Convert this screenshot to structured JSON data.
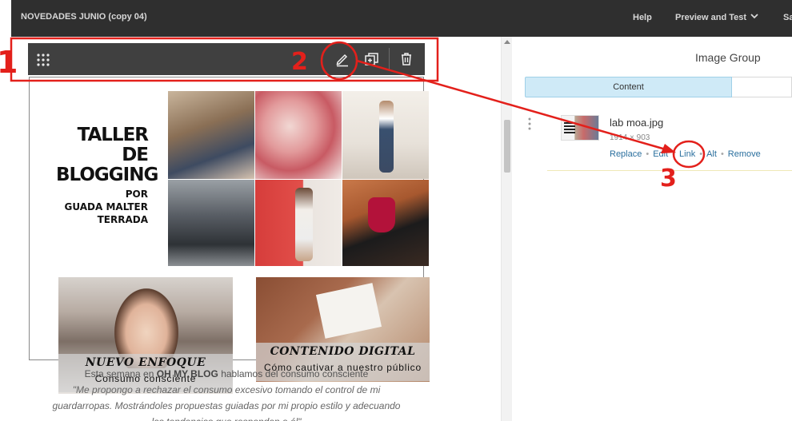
{
  "topbar": {
    "title": "NOVEDADES JUNIO (copy 04)",
    "help": "Help",
    "preview": "Preview and Test",
    "save": "Save"
  },
  "toolbar": {
    "icons": [
      "drag-grip-icon",
      "pencil-icon",
      "duplicate-icon",
      "trash-icon"
    ]
  },
  "email": {
    "headline": {
      "line1": "TALLER DE",
      "line2": "BLOGGING",
      "line3": "POR",
      "line4": "GUADA MALTER",
      "line5": "TERRADA"
    },
    "card1": {
      "title": "NUEVO ENFOQUE",
      "subtitle": "Consumo consciente"
    },
    "card2": {
      "title": "CONTENIDO DIGITAL",
      "subtitle": "Cómo cautivar a nuestro público"
    },
    "intro": {
      "prefix": "Esta semana en ",
      "brand": "OH MY BLOG",
      "suffix": " hablamos del consumo consciente",
      "quote_line1": "\"Me propongo a rechazar el consumo excesivo tomando el control de mi",
      "quote_line2": "guardarropas. Mostrándoles propuestas guiadas por mi propio estilo y adecuando",
      "quote_line3": "las tendencias que respondan a él\""
    }
  },
  "panel": {
    "title": "Image Group",
    "tabs": [
      {
        "label": "Content",
        "active": true
      },
      {
        "label": "",
        "active": false
      }
    ],
    "image": {
      "filename": "lab moa.jpg",
      "dimensions": "1914 × 903",
      "actions": [
        "Replace",
        "Edit",
        "Link",
        "Alt",
        "Remove"
      ]
    }
  },
  "annotations": {
    "labels": [
      "1",
      "2",
      "3"
    ],
    "color": "#e3201b"
  },
  "colors": {
    "topbar": "#2f2f2f",
    "toolbar": "#404040",
    "tab_active": "#cfeaf7",
    "link": "#2a6f9e"
  }
}
